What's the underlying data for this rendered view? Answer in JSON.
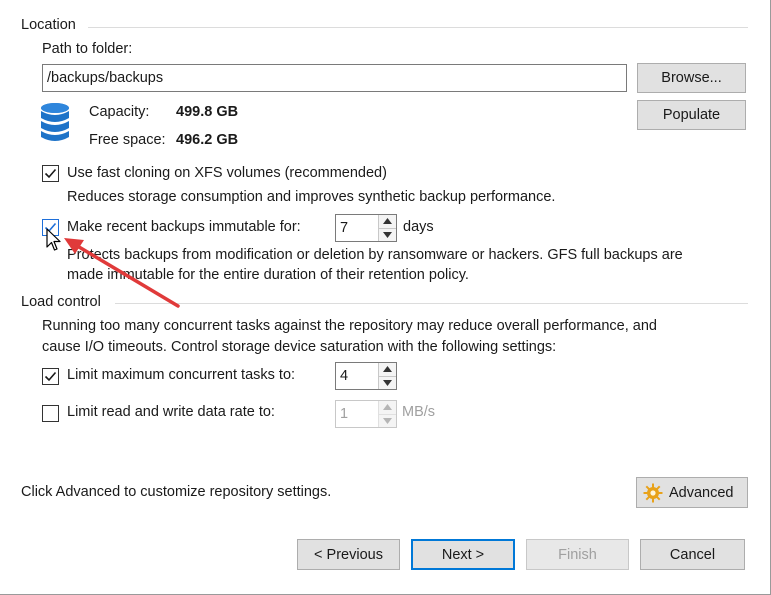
{
  "location": {
    "group_label": "Location",
    "path_label": "Path to folder:",
    "path_value": "/backups/backups",
    "browse_label": "Browse...",
    "populate_label": "Populate",
    "capacity_label": "Capacity:",
    "capacity_value": "499.8 GB",
    "free_label": "Free space:",
    "free_value": "496.2 GB",
    "fast_cloning": {
      "checked": true,
      "label": "Use fast cloning on XFS volumes (recommended)",
      "description": "Reduces storage consumption and improves synthetic backup performance."
    },
    "immutable": {
      "checked": true,
      "label": "Make recent backups immutable for:",
      "days_value": "7",
      "unit": "days",
      "description_line1": "Protects backups from modification or deletion by ransomware or hackers. GFS full backups are",
      "description_line2": "made immutable for the entire duration of their retention policy."
    }
  },
  "load_control": {
    "group_label": "Load control",
    "description_line1": "Running too many concurrent tasks against the repository may reduce overall performance, and",
    "description_line2": "cause I/O timeouts. Control storage device saturation with the following settings:",
    "max_tasks": {
      "checked": true,
      "label": "Limit maximum concurrent tasks to:",
      "value": "4"
    },
    "data_rate": {
      "checked": false,
      "label": "Limit read and write data rate to:",
      "value": "1",
      "unit": "MB/s"
    }
  },
  "advanced": {
    "hint": "Click Advanced to customize repository settings.",
    "button_label": "Advanced"
  },
  "footer": {
    "previous_label": "< Previous",
    "next_label": "Next >",
    "finish_label": "Finish",
    "cancel_label": "Cancel"
  },
  "icons": {
    "database": "database-icon",
    "gear": "gear-icon",
    "cursor": "mouse-pointer-icon",
    "annotation": "red-arrow-annotation"
  },
  "colors": {
    "accent": "#0078d7",
    "database_blue": "#1e73c8",
    "annotation_red": "#e03a3a",
    "gear_orange": "#e8a21a"
  }
}
